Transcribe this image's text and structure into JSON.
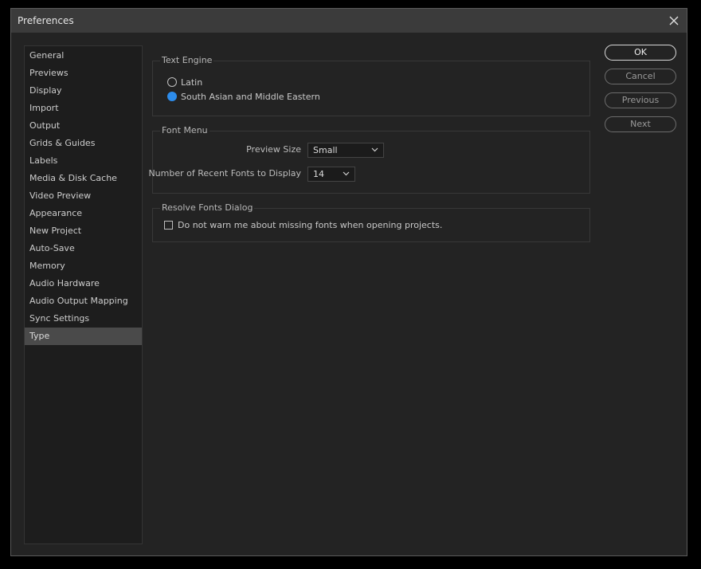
{
  "window": {
    "title": "Preferences"
  },
  "sidebar": {
    "items": [
      {
        "label": "General"
      },
      {
        "label": "Previews"
      },
      {
        "label": "Display"
      },
      {
        "label": "Import"
      },
      {
        "label": "Output"
      },
      {
        "label": "Grids & Guides"
      },
      {
        "label": "Labels"
      },
      {
        "label": "Media & Disk Cache"
      },
      {
        "label": "Video Preview"
      },
      {
        "label": "Appearance"
      },
      {
        "label": "New Project"
      },
      {
        "label": "Auto-Save"
      },
      {
        "label": "Memory"
      },
      {
        "label": "Audio Hardware"
      },
      {
        "label": "Audio Output Mapping"
      },
      {
        "label": "Sync Settings"
      },
      {
        "label": "Type"
      }
    ],
    "selected": "Type"
  },
  "text_engine": {
    "title": "Text Engine",
    "options": [
      {
        "label": "Latin",
        "checked": false
      },
      {
        "label": "South Asian and Middle Eastern",
        "checked": true
      }
    ]
  },
  "font_menu": {
    "title": "Font Menu",
    "preview_size_label": "Preview Size",
    "preview_size_value": "Small",
    "recent_fonts_label": "Number of Recent Fonts to Display",
    "recent_fonts_value": "14"
  },
  "resolve_fonts": {
    "title": "Resolve Fonts Dialog",
    "checkbox_label": "Do not warn me about missing fonts when opening projects.",
    "checked": false
  },
  "buttons": {
    "ok": "OK",
    "cancel": "Cancel",
    "previous": "Previous",
    "next": "Next"
  },
  "colors": {
    "accent": "#2d8ceb",
    "window_bg": "#232323",
    "titlebar_bg": "#3b3b3b"
  }
}
